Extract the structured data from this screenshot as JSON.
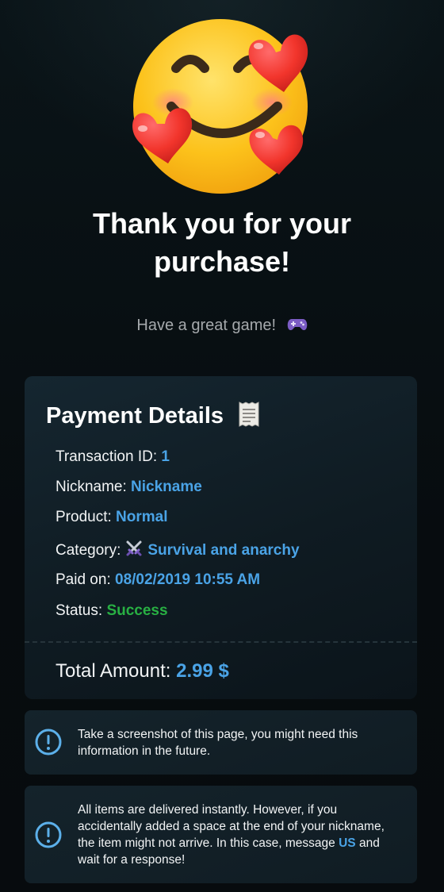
{
  "hero": {
    "emoji": "smiling-face-with-hearts"
  },
  "header": {
    "title_line1": "Thank you for your",
    "title_line2": "purchase!",
    "subtitle": "Have a great game!"
  },
  "payment": {
    "title": "Payment Details",
    "rows": [
      {
        "label": "Transaction ID:",
        "value": "1"
      },
      {
        "label": "Nickname:",
        "value": "Nickname"
      },
      {
        "label": "Product:",
        "value": "Normal"
      },
      {
        "label": "Category:",
        "value": "Survival and anarchy"
      },
      {
        "label": "Paid on:",
        "value": "08/02/2019 10:55 AM"
      },
      {
        "label": "Status:",
        "value": "Success"
      }
    ],
    "total_label": "Total Amount:",
    "total_value": "2.99 $"
  },
  "notices": {
    "screenshot": "Take a screenshot of this page, you might need this information in the future.",
    "delivery_before": "All items are delivered instantly. However, if you accidentally added a space at the end of your nickname, the item might not arrive. In this case, message ",
    "delivery_link": "US",
    "delivery_after": " and wait for a response!"
  },
  "colors": {
    "background": "#080e12",
    "card": "#13232c",
    "accent": "#4aa3e6",
    "success": "#28b043",
    "text": "#f2f4f5",
    "muted": "#a5a9ac"
  },
  "icons": {
    "subtitle": "gamepad-icon",
    "card_title": "receipt-icon",
    "category": "crossed-swords-icon",
    "notice": "exclamation-circle-icon"
  }
}
